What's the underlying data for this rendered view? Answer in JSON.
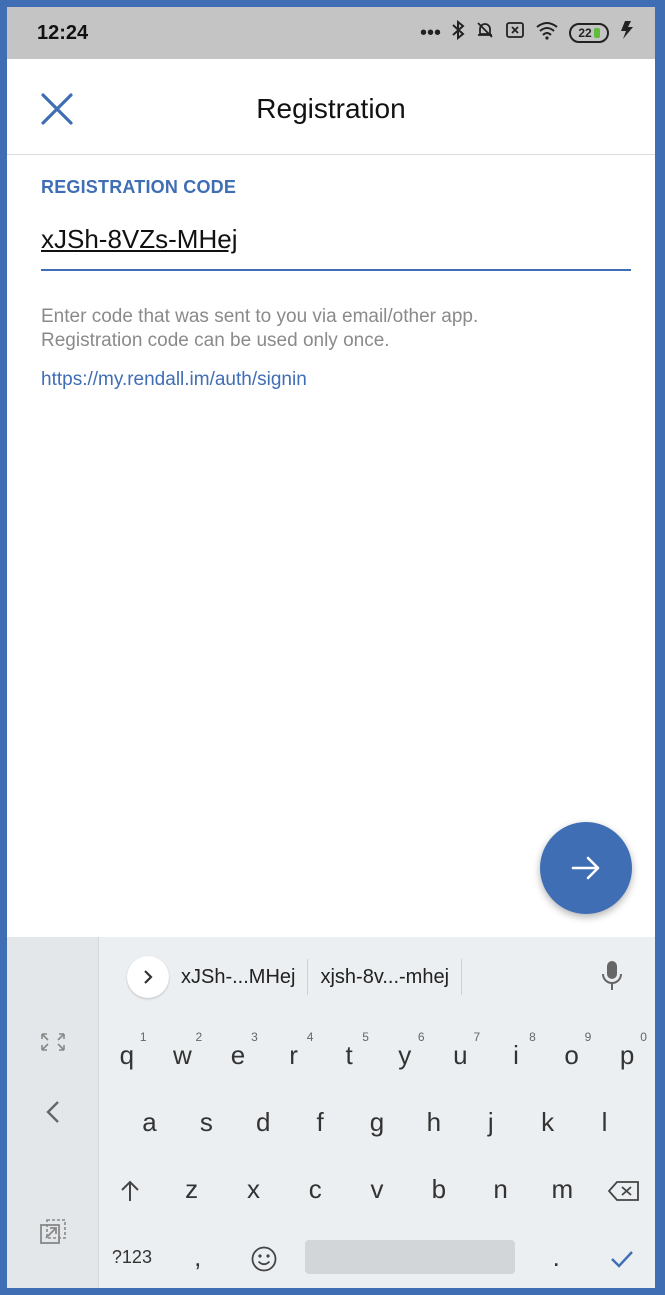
{
  "status_bar": {
    "time": "12:24",
    "battery": "22"
  },
  "app_bar": {
    "title": "Registration"
  },
  "form": {
    "code_label": "REGISTRATION CODE",
    "code_value": "xJSh-8VZs-MHej",
    "help_line1": "Enter code that was sent to you via email/other app.",
    "help_line2": "Registration code can be used only once.",
    "link": "https://my.rendall.im/auth/signin"
  },
  "keyboard": {
    "suggestions": [
      "xJSh-...MHej",
      "xjsh-8v...-mhej"
    ],
    "row1": [
      {
        "key": "q",
        "num": "1"
      },
      {
        "key": "w",
        "num": "2"
      },
      {
        "key": "e",
        "num": "3"
      },
      {
        "key": "r",
        "num": "4"
      },
      {
        "key": "t",
        "num": "5"
      },
      {
        "key": "y",
        "num": "6"
      },
      {
        "key": "u",
        "num": "7"
      },
      {
        "key": "i",
        "num": "8"
      },
      {
        "key": "o",
        "num": "9"
      },
      {
        "key": "p",
        "num": "0"
      }
    ],
    "row2": [
      "a",
      "s",
      "d",
      "f",
      "g",
      "h",
      "j",
      "k",
      "l"
    ],
    "row3_letters": [
      "z",
      "x",
      "c",
      "v",
      "b",
      "n",
      "m"
    ],
    "symbols_key": "?123",
    "comma_key": ",",
    "period_key": "."
  },
  "colors": {
    "accent": "#3f6eb5",
    "status_bar": "#c4c4c4",
    "keyboard_bg": "#eceff1"
  }
}
